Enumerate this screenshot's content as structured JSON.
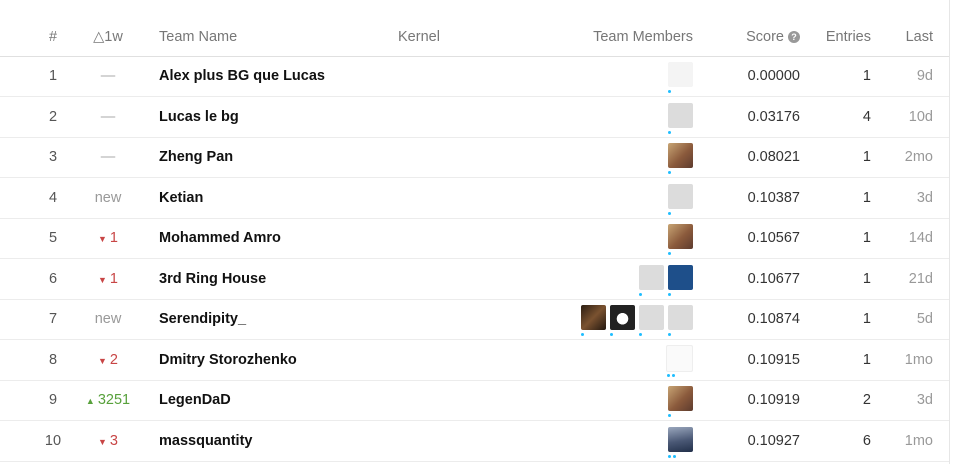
{
  "headers": {
    "rank": "#",
    "delta": "△1w",
    "team": "Team Name",
    "kernel": "Kernel",
    "members": "Team Members",
    "score": "Score",
    "entries": "Entries",
    "last": "Last"
  },
  "rows": [
    {
      "rank": "1",
      "delta": "—",
      "delta_kind": "same",
      "team": "Alex plus BG que Lucas",
      "score": "0.00000",
      "entries": "1",
      "last": "9d",
      "avatars": [
        "yellow-vest-avatar"
      ]
    },
    {
      "rank": "2",
      "delta": "—",
      "delta_kind": "same",
      "team": "Lucas le bg",
      "score": "0.03176",
      "entries": "4",
      "last": "10d",
      "avatars": [
        "default-avatar"
      ]
    },
    {
      "rank": "3",
      "delta": "—",
      "delta_kind": "same",
      "team": "Zheng Pan",
      "score": "0.08021",
      "entries": "1",
      "last": "2mo",
      "avatars": [
        "photo-avatar"
      ]
    },
    {
      "rank": "4",
      "delta": "new",
      "delta_kind": "new",
      "team": "Ketian",
      "score": "0.10387",
      "entries": "1",
      "last": "3d",
      "avatars": [
        "default-avatar"
      ]
    },
    {
      "rank": "5",
      "delta": "1",
      "delta_kind": "down",
      "team": "Mohammed Amro",
      "score": "0.10567",
      "entries": "1",
      "last": "14d",
      "avatars": [
        "photo-avatar"
      ]
    },
    {
      "rank": "6",
      "delta": "1",
      "delta_kind": "down",
      "team": "3rd Ring House",
      "score": "0.10677",
      "entries": "1",
      "last": "21d",
      "avatars": [
        "default-avatar",
        "cracked-glass-avatar"
      ]
    },
    {
      "rank": "7",
      "delta": "new",
      "delta_kind": "new",
      "team": "Serendipity_",
      "score": "0.10874",
      "entries": "1",
      "last": "5d",
      "avatars": [
        "cat-avatar",
        "panda-avatar",
        "default-avatar",
        "default-avatar"
      ]
    },
    {
      "rank": "8",
      "delta": "2",
      "delta_kind": "down",
      "team": "Dmitry Storozhenko",
      "score": "0.10915",
      "entries": "1",
      "last": "1mo",
      "avatars": [
        "text-avatar"
      ]
    },
    {
      "rank": "9",
      "delta": "3251",
      "delta_kind": "up",
      "team": "LegenDaD",
      "score": "0.10919",
      "entries": "2",
      "last": "3d",
      "avatars": [
        "photo-avatar"
      ]
    },
    {
      "rank": "10",
      "delta": "3",
      "delta_kind": "down",
      "team": "massquantity",
      "score": "0.10927",
      "entries": "6",
      "last": "1mo",
      "avatars": [
        "mountain-avatar"
      ]
    }
  ],
  "colors": {
    "down": "#c84545",
    "up": "#58a13c",
    "rank_dot": "#20beff"
  }
}
